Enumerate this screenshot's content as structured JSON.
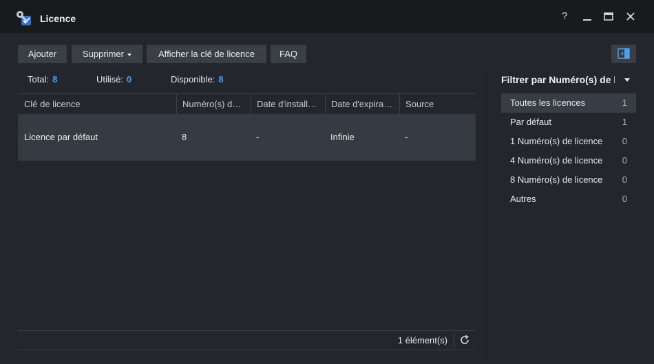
{
  "window": {
    "title": "Licence"
  },
  "toolbar": {
    "add": "Ajouter",
    "delete": "Supprimer",
    "show_key": "Afficher la clé de licence",
    "faq": "FAQ"
  },
  "stats": {
    "total_label": "Total:",
    "total_value": "8",
    "used_label": "Utilisé:",
    "used_value": "0",
    "available_label": "Disponible:",
    "available_value": "8"
  },
  "table": {
    "columns": [
      "Clé de licence",
      "Numéro(s) de licence",
      "Date d'installation",
      "Date d'expiration",
      "Source"
    ],
    "rows": [
      [
        "Licence par défaut",
        "8",
        "-",
        "Infinie",
        "-"
      ]
    ]
  },
  "footer": {
    "count": "1 élément(s)"
  },
  "filter": {
    "title": "Filtrer par Numéro(s) de licence",
    "items": [
      {
        "label": "Toutes les licences",
        "count": "1"
      },
      {
        "label": "Par défaut",
        "count": "1"
      },
      {
        "label": "1 Numéro(s) de licence",
        "count": "0"
      },
      {
        "label": "4 Numéro(s) de licence",
        "count": "0"
      },
      {
        "label": "8 Numéro(s) de licence",
        "count": "0"
      },
      {
        "label": "Autres",
        "count": "0"
      }
    ]
  },
  "colors": {
    "accent": "#4a9ff5",
    "background": "#23262c",
    "titlebar": "#181a1e",
    "selected_row": "#363a43"
  },
  "icons": [
    "key-app-icon",
    "help-icon",
    "minimize-icon",
    "maximize-icon",
    "close-icon",
    "panel-toggle-icon",
    "refresh-icon"
  ]
}
